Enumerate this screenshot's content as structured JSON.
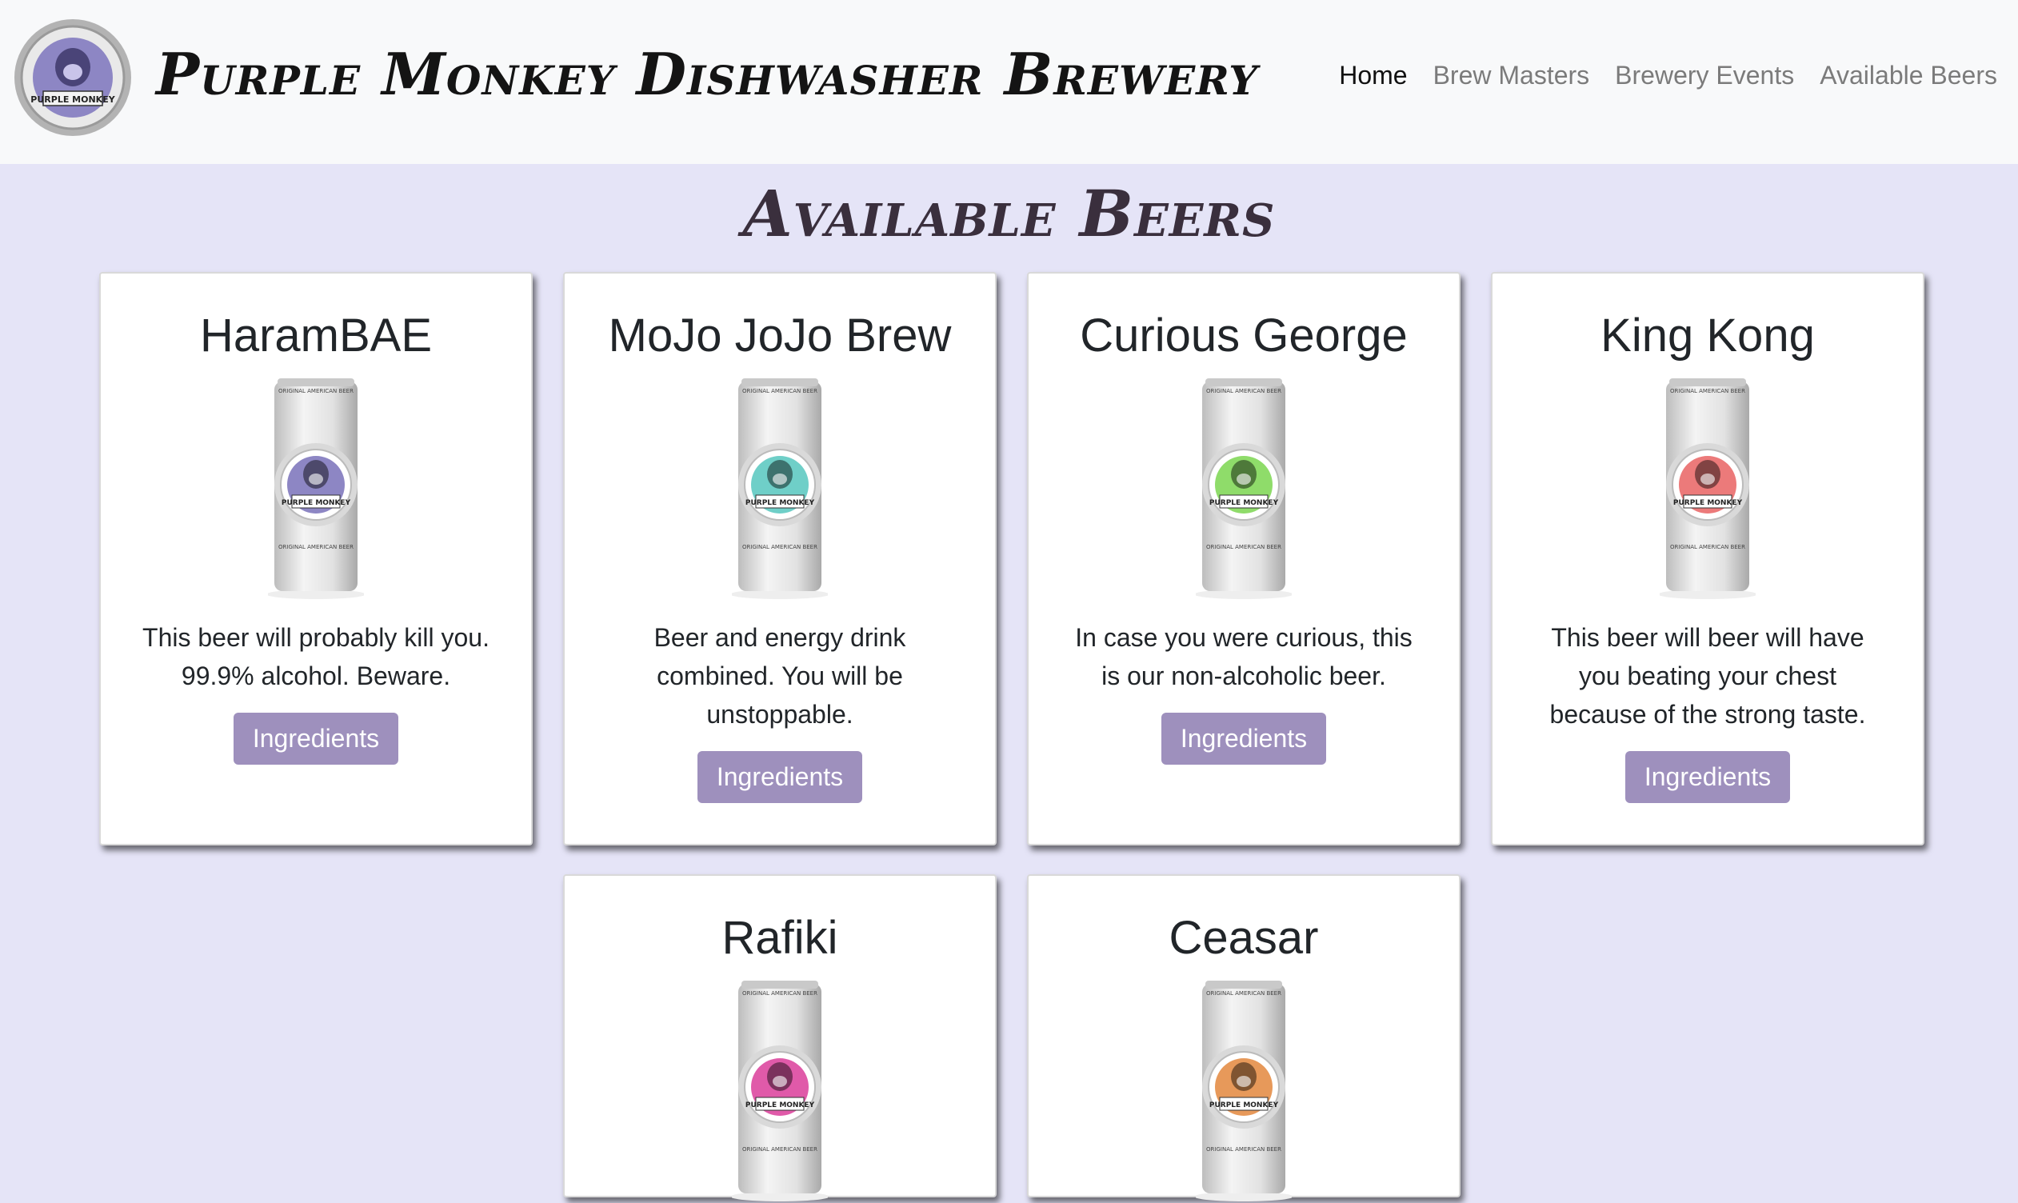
{
  "header": {
    "brand": "Purple Monkey Dishwasher Brewery",
    "logo_text": "PURPLE MONKEY",
    "nav": [
      "Home",
      "Brew Masters",
      "Brewery Events",
      "Available Beers"
    ]
  },
  "page_title": "Available Beers",
  "beers": [
    {
      "name": "HaramBAE",
      "description": "This beer will probably kill you. 99.9% alcohol. Beware.",
      "button": "Ingredients",
      "label_color": "#8d86c4"
    },
    {
      "name": "MoJo JoJo Brew",
      "description": "Beer and energy drink combined. You will be unstoppable.",
      "button": "Ingredients",
      "label_color": "#6fcfc8"
    },
    {
      "name": "Curious George",
      "description": "In case you were curious, this is our non-alcoholic beer.",
      "button": "Ingredients",
      "label_color": "#8fdc6a"
    },
    {
      "name": "King Kong",
      "description": "This beer will beer will have you beating your chest because of the strong taste.",
      "button": "Ingredients",
      "label_color": "#ec7a7a"
    },
    {
      "name": "Rafiki",
      "label_color": "#e05aa9"
    },
    {
      "name": "Ceasar",
      "label_color": "#e7995a"
    }
  ],
  "can_text": {
    "top": "ORIGINAL AMERICAN BEER",
    "badge": "PURPLE MONKEY",
    "bottom": "ORIGINAL AMERICAN BEER"
  }
}
